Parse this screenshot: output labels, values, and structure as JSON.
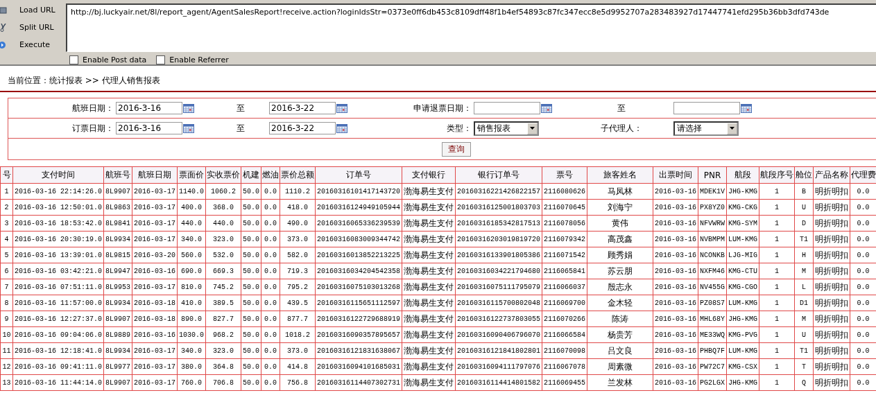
{
  "toolbar": {
    "buttons": [
      {
        "label": "Load URL"
      },
      {
        "label": "Split URL"
      },
      {
        "label": "Execute"
      }
    ],
    "url": "http://bj.luckyair.net/8l/report_agent/AgentSalesReport!receive.action?loginIdsStr=0373e0ff6db453c8109dff48f1b4ef54893c87fc347ecc8e5d9952707a283483927d17447741efd295b36bb3dfd743de",
    "options": [
      {
        "label": "Enable Post data",
        "checked": false
      },
      {
        "label": "Enable Referrer",
        "checked": false
      }
    ]
  },
  "breadcrumb": "当前位置：统计报表 >> 代理人销售报表",
  "filters": {
    "rows": [
      [
        {
          "kind": "date",
          "label": "航班日期：",
          "value": "2016-3-16"
        },
        {
          "kind": "date",
          "label": "至",
          "value": "2016-3-22"
        },
        {
          "kind": "date",
          "label": "申请退票日期："
        },
        {
          "kind": "date",
          "label": "至"
        }
      ],
      [
        {
          "kind": "date",
          "label": "订票日期：",
          "value": "2016-3-16"
        },
        {
          "kind": "date",
          "label": "至",
          "value": "2016-3-22"
        },
        {
          "kind": "select",
          "label": "类型：",
          "value": "销售报表"
        },
        {
          "kind": "select",
          "label": "子代理人：",
          "value": "请选择"
        }
      ]
    ],
    "query_button": "查询"
  },
  "table": {
    "columns": [
      "号",
      "支付时间",
      "航班号",
      "航班日期",
      "票面价",
      "实收票价",
      "机建",
      "燃油",
      "票价总额",
      "订单号",
      "支付银行",
      "银行订单号",
      "票号",
      "旅客姓名",
      "出票时间",
      "PNR",
      "航段",
      "航段序号",
      "舱位",
      "产品名称",
      "代理费"
    ],
    "rows": [
      [
        "1",
        "2016-03-16 22:14:26.0",
        "8L9907",
        "2016-03-17",
        "1140.0",
        "1060.2",
        "50.0",
        "0.0",
        "1110.2",
        "20160316101417143720",
        "渤海易生支付",
        "20160316221426822157",
        "2116080626",
        "马凤林",
        "2016-03-16",
        "MDEK1V",
        "JHG-KMG",
        "1",
        "B",
        "明折明扣",
        "0.0"
      ],
      [
        "2",
        "2016-03-16 12:50:01.0",
        "8L9863",
        "2016-03-17",
        "400.0",
        "368.0",
        "50.0",
        "0.0",
        "418.0",
        "20160316124949105944",
        "渤海易生支付",
        "20160316125001803703",
        "2116070645",
        "刘海宁",
        "2016-03-16",
        "PX8YZ0",
        "KMG-CKG",
        "1",
        "U",
        "明折明扣",
        "0.0"
      ],
      [
        "3",
        "2016-03-16 18:53:42.0",
        "8L9841",
        "2016-03-17",
        "440.0",
        "440.0",
        "50.0",
        "0.0",
        "490.0",
        "20160316065336239539",
        "渤海易生支付",
        "20160316185342817513",
        "2116078056",
        "黄伟",
        "2016-03-16",
        "NFVWRW",
        "KMG-SYM",
        "1",
        "D",
        "明折明扣",
        "0.0"
      ],
      [
        "4",
        "2016-03-16 20:30:19.0",
        "8L9934",
        "2016-03-17",
        "340.0",
        "323.0",
        "50.0",
        "0.0",
        "373.0",
        "20160316083009344742",
        "渤海易生支付",
        "20160316203019819720",
        "2116079342",
        "高茂鑫",
        "2016-03-16",
        "NVBMPM",
        "LUM-KMG",
        "1",
        "T1",
        "明折明扣",
        "0.0"
      ],
      [
        "5",
        "2016-03-16 13:39:01.0",
        "8L9815",
        "2016-03-20",
        "560.0",
        "532.0",
        "50.0",
        "0.0",
        "582.0",
        "20160316013852213225",
        "渤海易生支付",
        "20160316133901805386",
        "2116071542",
        "顾秀娟",
        "2016-03-16",
        "NCONKB",
        "LJG-MIG",
        "1",
        "H",
        "明折明扣",
        "0.0"
      ],
      [
        "6",
        "2016-03-16 03:42:21.0",
        "8L9947",
        "2016-03-16",
        "690.0",
        "669.3",
        "50.0",
        "0.0",
        "719.3",
        "20160316034204542358",
        "渤海易生支付",
        "20160316034221794680",
        "2116065841",
        "苏云朋",
        "2016-03-16",
        "NXFM46",
        "KMG-CTU",
        "1",
        "M",
        "明折明扣",
        "0.0"
      ],
      [
        "7",
        "2016-03-16 07:51:11.0",
        "8L9953",
        "2016-03-17",
        "810.0",
        "745.2",
        "50.0",
        "0.0",
        "795.2",
        "20160316075103013268",
        "渤海易生支付",
        "20160316075111795079",
        "2116066037",
        "殷志永",
        "2016-03-16",
        "NV455G",
        "KMG-CGO",
        "1",
        "L",
        "明折明扣",
        "0.0"
      ],
      [
        "8",
        "2016-03-16 11:57:00.0",
        "8L9934",
        "2016-03-18",
        "410.0",
        "389.5",
        "50.0",
        "0.0",
        "439.5",
        "20160316115651112597",
        "渤海易生支付",
        "20160316115700802048",
        "2116069700",
        "金木轻",
        "2016-03-16",
        "PZ08S7",
        "LUM-KMG",
        "1",
        "D1",
        "明折明扣",
        "0.0"
      ],
      [
        "9",
        "2016-03-16 12:27:37.0",
        "8L9907",
        "2016-03-18",
        "890.0",
        "827.7",
        "50.0",
        "0.0",
        "877.7",
        "20160316122729688919",
        "渤海易生支付",
        "20160316122737803055",
        "2116070266",
        "陈涛",
        "2016-03-16",
        "MHL68Y",
        "JHG-KMG",
        "1",
        "M",
        "明折明扣",
        "0.0"
      ],
      [
        "10",
        "2016-03-16 09:04:06.0",
        "8L9889",
        "2016-03-16",
        "1030.0",
        "968.2",
        "50.0",
        "0.0",
        "1018.2",
        "20160316090357895657",
        "渤海易生支付",
        "20160316090406796070",
        "2116066584",
        "杨贵芳",
        "2016-03-16",
        "ME33WQ",
        "KMG-PVG",
        "1",
        "U",
        "明折明扣",
        "0.0"
      ],
      [
        "11",
        "2016-03-16 12:18:41.0",
        "8L9934",
        "2016-03-17",
        "340.0",
        "323.0",
        "50.0",
        "0.0",
        "373.0",
        "20160316121831638067",
        "渤海易生支付",
        "20160316121841802801",
        "2116070098",
        "吕文良",
        "2016-03-16",
        "PHBQ7F",
        "LUM-KMG",
        "1",
        "T1",
        "明折明扣",
        "0.0"
      ],
      [
        "12",
        "2016-03-16 09:41:11.0",
        "8L9977",
        "2016-03-17",
        "380.0",
        "364.8",
        "50.0",
        "0.0",
        "414.8",
        "20160316094101685031",
        "渤海易生支付",
        "20160316094111797076",
        "2116067078",
        "周素微",
        "2016-03-16",
        "PW72C7",
        "KMG-CSX",
        "1",
        "T",
        "明折明扣",
        "0.0"
      ],
      [
        "13",
        "2016-03-16 11:44:14.0",
        "8L9907",
        "2016-03-17",
        "760.0",
        "706.8",
        "50.0",
        "0.0",
        "756.8",
        "20160316114407302731",
        "渤海易生支付",
        "20160316114414801582",
        "2116069455",
        "兰发林",
        "2016-03-16",
        "PG2LGX",
        "JHG-KMG",
        "1",
        "Q",
        "明折明扣",
        "0.0"
      ]
    ]
  }
}
